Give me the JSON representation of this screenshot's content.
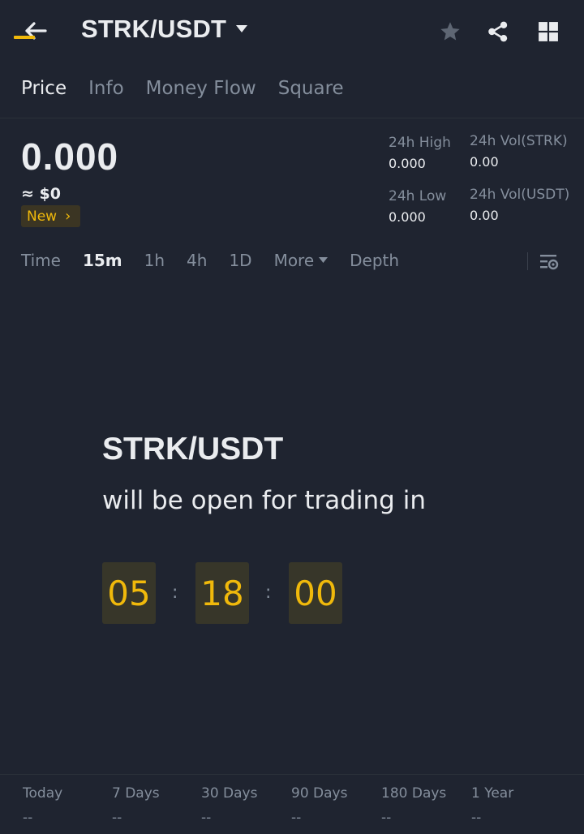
{
  "header": {
    "back_icon": "arrow-left-icon",
    "pair": "STRK/USDT",
    "icons": [
      "star-icon",
      "share-icon",
      "grid-icon"
    ]
  },
  "tabs": [
    {
      "label": "Price",
      "active": true
    },
    {
      "label": "Info",
      "active": false
    },
    {
      "label": "Money Flow",
      "active": false
    },
    {
      "label": "Square",
      "active": false
    }
  ],
  "price": {
    "last": "0.000",
    "usd": "≈ $0",
    "badge": "New",
    "badge_chevron": "›"
  },
  "stats": {
    "high_label": "24h High",
    "high_value": "0.000",
    "low_label": "24h Low",
    "low_value": "0.000",
    "vol_base_label": "24h Vol(STRK)",
    "vol_base_value": "0.00",
    "vol_quote_label": "24h Vol(USDT)",
    "vol_quote_value": "0.00"
  },
  "intervals": [
    {
      "label": "Time",
      "active": false
    },
    {
      "label": "15m",
      "active": true
    },
    {
      "label": "1h",
      "active": false
    },
    {
      "label": "4h",
      "active": false
    },
    {
      "label": "1D",
      "active": false
    },
    {
      "label": "More",
      "active": false
    },
    {
      "label": "Depth",
      "active": false
    }
  ],
  "countdown": {
    "pair": "STRK/USDT",
    "message": "will be open for trading in",
    "hours": "05",
    "minutes": "18",
    "seconds": "00",
    "separator": ":"
  },
  "performance": [
    {
      "label": "Today",
      "value": "--"
    },
    {
      "label": "7 Days",
      "value": "--"
    },
    {
      "label": "30 Days",
      "value": "--"
    },
    {
      "label": "90 Days",
      "value": "--"
    },
    {
      "label": "180 Days",
      "value": "--"
    },
    {
      "label": "1 Year",
      "value": "--"
    }
  ],
  "colors": {
    "background": "#1f2430",
    "accent": "#f0b90b",
    "text_primary": "#eaecef",
    "text_secondary": "#848e9c"
  }
}
